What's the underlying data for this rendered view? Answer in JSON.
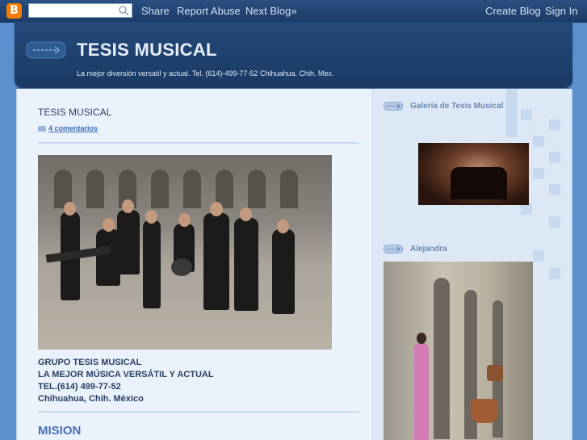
{
  "navbar": {
    "logo_letter": "B",
    "search_value": "",
    "share": "Share",
    "report_abuse": "Report Abuse",
    "next_blog": "Next Blog»",
    "create_blog": "Create Blog",
    "sign_in": "Sign In"
  },
  "header": {
    "title": "TESIS MUSICAL",
    "description": "La mejor diversión versatil y actual. Tel. (614)-499-77-52 Chihuahua. Chih. Mex."
  },
  "post": {
    "title": "TESIS MUSICAL",
    "comments": "4 comentarios",
    "lines": [
      "GRUPO TESIS MUSICAL",
      "LA MEJOR MÚSICA VERSÁTIL Y ACTUAL",
      "TEL.(614) 499-77-52",
      "Chihuahua, Chih. México"
    ],
    "mision": "MISION"
  },
  "sidebar": {
    "widgets": [
      {
        "title": "Galería de Tesis Musical"
      },
      {
        "title": "Alejandra"
      }
    ]
  },
  "colors": {
    "navbar": "#1d3b66",
    "header": "#24497a",
    "accent": "#3d6cb0",
    "logo": "#f57d00"
  }
}
